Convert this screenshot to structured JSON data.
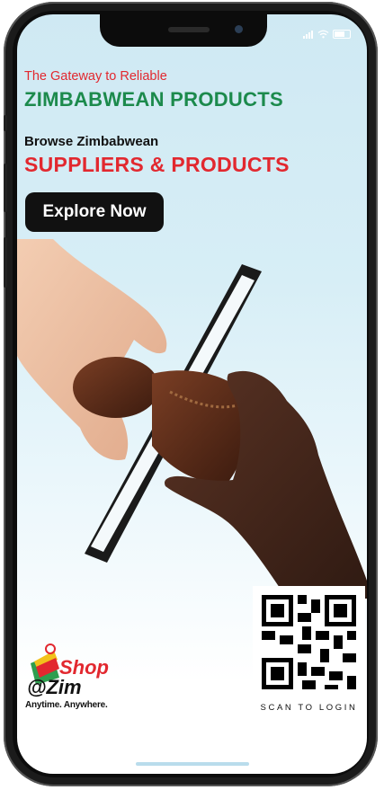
{
  "status_bar": {
    "signal_icon": "signal-icon",
    "wifi_icon": "wifi-icon",
    "battery_icon": "battery-icon"
  },
  "hero": {
    "tagline_top": "The Gateway to Reliable",
    "headline_top": "ZIMBABWEAN PRODUCTS",
    "tagline_bottom": "Browse Zimbabwean",
    "headline_bottom": "SUPPLIERS & PRODUCTS",
    "cta_label": "Explore Now"
  },
  "qr": {
    "caption": "SCAN TO LOGIN"
  },
  "brand": {
    "logo_line1": "Shop",
    "logo_line2": "@Zim",
    "slogan": "Anytime. Anywhere."
  },
  "colors": {
    "accent_red": "#e2282f",
    "accent_green": "#1c8a4c",
    "button_bg": "#111111"
  }
}
